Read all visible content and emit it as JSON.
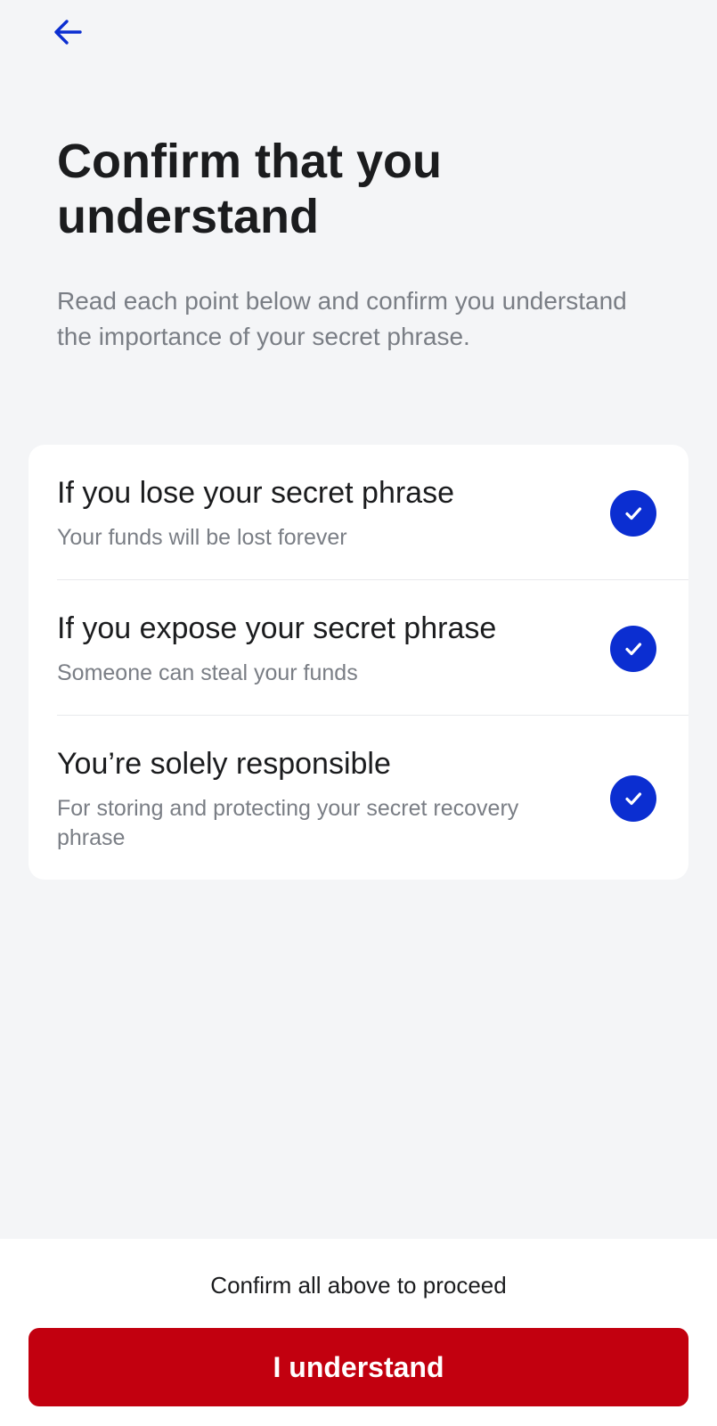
{
  "icons": {
    "back": "arrow-left-icon",
    "check": "checkmark-icon"
  },
  "colors": {
    "accent": "#0b2ed1",
    "primary_button": "#c2000f",
    "background": "#f4f5f7"
  },
  "header": {
    "title": "Confirm that you understand",
    "subtitle": "Read each point below and confirm you understand the importance of your secret phrase."
  },
  "points": [
    {
      "title": "If you lose your secret phrase",
      "description": "Your funds will be lost forever",
      "checked": true
    },
    {
      "title": "If you expose your secret phrase",
      "description": "Someone can steal your funds",
      "checked": true
    },
    {
      "title": "You’re solely responsible",
      "description": "For storing and protecting your secret recovery phrase",
      "checked": true
    }
  ],
  "footer": {
    "hint": "Confirm all above to proceed",
    "button_label": "I understand"
  }
}
